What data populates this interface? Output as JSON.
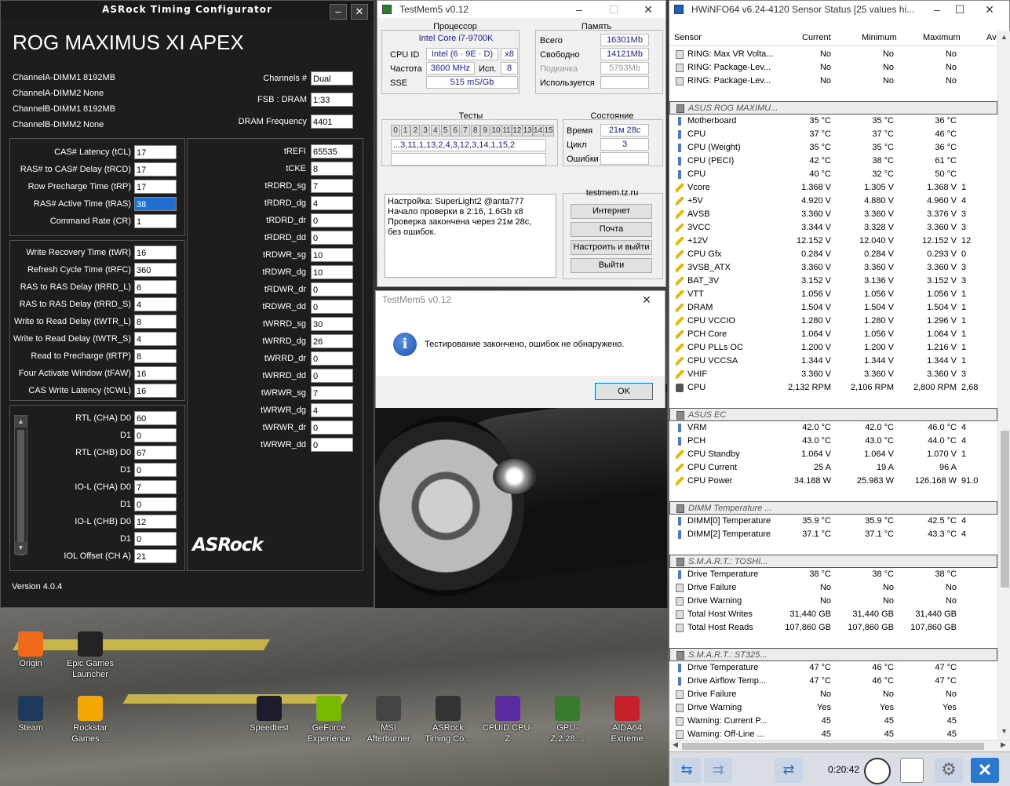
{
  "asrock": {
    "title": "ASRock Timing Configurator",
    "model": "ROG MAXIMUS XI APEX",
    "dimms": [
      {
        "slot": "ChannelA-DIMM1",
        "value": "8192MB"
      },
      {
        "slot": "ChannelA-DIMM2",
        "value": "None"
      },
      {
        "slot": "ChannelB-DIMM1",
        "value": "8192MB"
      },
      {
        "slot": "ChannelB-DIMM2",
        "value": "None"
      }
    ],
    "info": [
      {
        "label": "Channels #",
        "value": "Dual"
      },
      {
        "label": "FSB : DRAM",
        "value": "1:33"
      },
      {
        "label": "DRAM Frequency",
        "value": "4401"
      }
    ],
    "primary": [
      {
        "label": "CAS# Latency (tCL)",
        "value": "17"
      },
      {
        "label": "RAS# to CAS# Delay (tRCD)",
        "value": "17"
      },
      {
        "label": "Row Precharge Time (tRP)",
        "value": "17"
      },
      {
        "label": "RAS# Active Time (tRAS)",
        "value": "38"
      },
      {
        "label": "Command Rate (CR)",
        "value": "1"
      }
    ],
    "secondary": [
      {
        "label": "Write Recovery Time (tWR)",
        "value": "16"
      },
      {
        "label": "Refresh Cycle Time (tRFC)",
        "value": "360"
      },
      {
        "label": "RAS to RAS Delay (tRRD_L)",
        "value": "6"
      },
      {
        "label": "RAS to RAS Delay (tRRD_S)",
        "value": "4"
      },
      {
        "label": "Write to Read Delay (tWTR_L)",
        "value": "8"
      },
      {
        "label": "Write to Read Delay (tWTR_S)",
        "value": "4"
      },
      {
        "label": "Read to Precharge (tRTP)",
        "value": "8"
      },
      {
        "label": "Four Activate Window (tFAW)",
        "value": "16"
      },
      {
        "label": "CAS Write Latency (tCWL)",
        "value": "16"
      }
    ],
    "third": [
      {
        "label": "RTL (CHA) D0",
        "value": "60"
      },
      {
        "label": "D1",
        "value": "0"
      },
      {
        "label": "RTL (CHB) D0",
        "value": "67"
      },
      {
        "label": "D1",
        "value": "0"
      },
      {
        "label": "IO-L (CHA) D0",
        "value": "7"
      },
      {
        "label": "D1",
        "value": "0"
      },
      {
        "label": "IO-L (CHB) D0",
        "value": "12"
      },
      {
        "label": "D1",
        "value": "0"
      },
      {
        "label": "IOL Offset (CH A)",
        "value": "21"
      }
    ],
    "right": [
      {
        "label": "tREFI",
        "value": "65535"
      },
      {
        "label": "tCKE",
        "value": "8"
      },
      {
        "label": "tRDRD_sg",
        "value": "7"
      },
      {
        "label": "tRDRD_dg",
        "value": "4"
      },
      {
        "label": "tRDRD_dr",
        "value": "0"
      },
      {
        "label": "tRDRD_dd",
        "value": "0"
      },
      {
        "label": "tRDWR_sg",
        "value": "10"
      },
      {
        "label": "tRDWR_dg",
        "value": "10"
      },
      {
        "label": "tRDWR_dr",
        "value": "0"
      },
      {
        "label": "tRDWR_dd",
        "value": "0"
      },
      {
        "label": "tWRRD_sg",
        "value": "30"
      },
      {
        "label": "tWRRD_dg",
        "value": "26"
      },
      {
        "label": "tWRRD_dr",
        "value": "0"
      },
      {
        "label": "tWRRD_dd",
        "value": "0"
      },
      {
        "label": "tWRWR_sg",
        "value": "7"
      },
      {
        "label": "tWRWR_dg",
        "value": "4"
      },
      {
        "label": "tWRWR_dr",
        "value": "0"
      },
      {
        "label": "tWRWR_dd",
        "value": "0"
      }
    ],
    "logo": "ASRock",
    "version": "Version 4.0.4"
  },
  "testmem": {
    "title": "TestMem5 v0.12",
    "cpu": {
      "header": "Процессор",
      "name": "Intel Core i7-9700K",
      "cpuid_label": "CPU ID",
      "cpuid": "Intel  (6 · 9E · D)",
      "cpuid_x": "x8",
      "freq_label": "Частота",
      "freq": "3600 MHz",
      "use_label": "Исп.",
      "use": "8",
      "sse_label": "SSE",
      "sse": "515 mS/Gb"
    },
    "mem": {
      "header": "Память",
      "total_label": "Всего",
      "total": "16301Mb",
      "free_label": "Свободно",
      "free": "14121Mb",
      "swap_label": "Подкачка",
      "swap": "5793Mb",
      "used_label": "Используется",
      "used": ""
    },
    "tests": {
      "header": "Тесты",
      "nums": [
        "0",
        "1",
        "2",
        "3",
        "4",
        "5",
        "6",
        "7",
        "8",
        "9",
        "10",
        "11",
        "12",
        "13",
        "14",
        "15"
      ],
      "sequence": "...3,11,1,13,2,4,3,12,3,14,1,15,2"
    },
    "state": {
      "header": "Состояние",
      "time_label": "Время",
      "time": "21м 28с",
      "cycle_label": "Цикл",
      "cycle": "3",
      "err_label": "Ошибки",
      "err": ""
    },
    "log": "Настройка: SuperLight2 @anta777\nНачало проверки в 2:16, 1.6Gb x8\nПроверка закончена через 21м 28с,\nбез ошибок.",
    "site": "testmem.tz.ru",
    "buttons": [
      "Интернет",
      "Почта",
      "Настроить и выйти",
      "Выйти"
    ]
  },
  "dialog": {
    "title": "TestMem5 v0.12",
    "message": "Тестирование закончено, ошибок не обнаружено.",
    "ok": "OK"
  },
  "hwinfo": {
    "title": "HWiNFO64 v6.24-4120 Sensor Status [25 values hi...",
    "columns": [
      "Sensor",
      "Current",
      "Minimum",
      "Maximum",
      "Av"
    ],
    "rows": [
      {
        "t": "sq",
        "n": "RING: Max VR Volta...",
        "c": "No",
        "mn": "No",
        "mx": "No",
        "av": ""
      },
      {
        "t": "sq",
        "n": "RING: Package-Lev...",
        "c": "No",
        "mn": "No",
        "mx": "No",
        "av": ""
      },
      {
        "t": "sq",
        "n": "RING: Package-Lev...",
        "c": "No",
        "mn": "No",
        "mx": "No",
        "av": ""
      },
      {
        "t": "gap"
      },
      {
        "t": "grp",
        "n": "ASUS ROG MAXIMU..."
      },
      {
        "t": "temp",
        "n": "Motherboard",
        "c": "35 °C",
        "mn": "35 °C",
        "mx": "36 °C",
        "av": ""
      },
      {
        "t": "temp",
        "n": "CPU",
        "c": "37 °C",
        "mn": "37 °C",
        "mx": "46 °C",
        "av": ""
      },
      {
        "t": "temp",
        "n": "CPU (Weight)",
        "c": "35 °C",
        "mn": "35 °C",
        "mx": "36 °C",
        "av": ""
      },
      {
        "t": "temp",
        "n": "CPU (PECI)",
        "c": "42 °C",
        "mn": "38 °C",
        "mx": "61 °C",
        "av": ""
      },
      {
        "t": "temp",
        "n": "CPU",
        "c": "40 °C",
        "mn": "32 °C",
        "mx": "50 °C",
        "av": ""
      },
      {
        "t": "volt",
        "n": "Vcore",
        "c": "1.368 V",
        "mn": "1.305 V",
        "mx": "1.368 V",
        "av": "1"
      },
      {
        "t": "volt",
        "n": "+5V",
        "c": "4.920 V",
        "mn": "4.880 V",
        "mx": "4.960 V",
        "av": "4"
      },
      {
        "t": "volt",
        "n": "AVSB",
        "c": "3.360 V",
        "mn": "3.360 V",
        "mx": "3.376 V",
        "av": "3"
      },
      {
        "t": "volt",
        "n": "3VCC",
        "c": "3.344 V",
        "mn": "3.328 V",
        "mx": "3.360 V",
        "av": "3"
      },
      {
        "t": "volt",
        "n": "+12V",
        "c": "12.152 V",
        "mn": "12.040 V",
        "mx": "12.152 V",
        "av": "12"
      },
      {
        "t": "volt",
        "n": "CPU Gfx",
        "c": "0.284 V",
        "mn": "0.284 V",
        "mx": "0.293 V",
        "av": "0"
      },
      {
        "t": "volt",
        "n": "3VSB_ATX",
        "c": "3.360 V",
        "mn": "3.360 V",
        "mx": "3.360 V",
        "av": "3"
      },
      {
        "t": "volt",
        "n": "BAT_3V",
        "c": "3.152 V",
        "mn": "3.136 V",
        "mx": "3.152 V",
        "av": "3"
      },
      {
        "t": "volt",
        "n": "VTT",
        "c": "1.056 V",
        "mn": "1.056 V",
        "mx": "1.056 V",
        "av": "1"
      },
      {
        "t": "volt",
        "n": "DRAM",
        "c": "1.504 V",
        "mn": "1.504 V",
        "mx": "1.504 V",
        "av": "1"
      },
      {
        "t": "volt",
        "n": "CPU VCCIO",
        "c": "1.280 V",
        "mn": "1.280 V",
        "mx": "1.296 V",
        "av": "1"
      },
      {
        "t": "volt",
        "n": "PCH Core",
        "c": "1.064 V",
        "mn": "1.056 V",
        "mx": "1.064 V",
        "av": "1"
      },
      {
        "t": "volt",
        "n": "CPU PLLs OC",
        "c": "1.200 V",
        "mn": "1.200 V",
        "mx": "1.216 V",
        "av": "1"
      },
      {
        "t": "volt",
        "n": "CPU VCCSA",
        "c": "1.344 V",
        "mn": "1.344 V",
        "mx": "1.344 V",
        "av": "1"
      },
      {
        "t": "volt",
        "n": "VHIF",
        "c": "3.360 V",
        "mn": "3.360 V",
        "mx": "3.360 V",
        "av": "3"
      },
      {
        "t": "fan",
        "n": "CPU",
        "c": "2,132 RPM",
        "mn": "2,106 RPM",
        "mx": "2,800 RPM",
        "av": "2,68"
      },
      {
        "t": "gap"
      },
      {
        "t": "grp",
        "n": "ASUS EC"
      },
      {
        "t": "temp",
        "n": "VRM",
        "c": "42.0 °C",
        "mn": "42.0 °C",
        "mx": "46.0 °C",
        "av": "4"
      },
      {
        "t": "temp",
        "n": "PCH",
        "c": "43.0 °C",
        "mn": "43.0 °C",
        "mx": "44.0 °C",
        "av": "4"
      },
      {
        "t": "volt",
        "n": "CPU Standby",
        "c": "1.064 V",
        "mn": "1.064 V",
        "mx": "1.070 V",
        "av": "1"
      },
      {
        "t": "volt",
        "n": "CPU Current",
        "c": "25 A",
        "mn": "19 A",
        "mx": "96 A",
        "av": ""
      },
      {
        "t": "volt",
        "n": "CPU Power",
        "c": "34.188 W",
        "mn": "25.983 W",
        "mx": "126.168 W",
        "av": "91.0"
      },
      {
        "t": "gap"
      },
      {
        "t": "grp",
        "n": "DIMM Temperature ..."
      },
      {
        "t": "temp",
        "n": "DIMM[0] Temperature",
        "c": "35.9 °C",
        "mn": "35.9 °C",
        "mx": "42.5 °C",
        "av": "4"
      },
      {
        "t": "temp",
        "n": "DIMM[2] Temperature",
        "c": "37.1 °C",
        "mn": "37.1 °C",
        "mx": "43.3 °C",
        "av": "4"
      },
      {
        "t": "gap"
      },
      {
        "t": "grp",
        "n": "S.M.A.R.T.: TOSHI..."
      },
      {
        "t": "temp",
        "n": "Drive Temperature",
        "c": "38 °C",
        "mn": "38 °C",
        "mx": "38 °C",
        "av": ""
      },
      {
        "t": "sq",
        "n": "Drive Failure",
        "c": "No",
        "mn": "No",
        "mx": "No",
        "av": ""
      },
      {
        "t": "sq",
        "n": "Drive Warning",
        "c": "No",
        "mn": "No",
        "mx": "No",
        "av": ""
      },
      {
        "t": "sq",
        "n": "Total Host Writes",
        "c": "31,440 GB",
        "mn": "31,440 GB",
        "mx": "31,440 GB",
        "av": ""
      },
      {
        "t": "sq",
        "n": "Total Host Reads",
        "c": "107,860 GB",
        "mn": "107,860 GB",
        "mx": "107,860 GB",
        "av": ""
      },
      {
        "t": "gap"
      },
      {
        "t": "grp",
        "n": "S.M.A.R.T.: ST325..."
      },
      {
        "t": "temp",
        "n": "Drive Temperature",
        "c": "47 °C",
        "mn": "46 °C",
        "mx": "47 °C",
        "av": ""
      },
      {
        "t": "temp",
        "n": "Drive Airflow Temp...",
        "c": "47 °C",
        "mn": "46 °C",
        "mx": "47 °C",
        "av": ""
      },
      {
        "t": "sq",
        "n": "Drive Failure",
        "c": "No",
        "mn": "No",
        "mx": "No",
        "av": ""
      },
      {
        "t": "sq",
        "n": "Drive Warning",
        "c": "Yes",
        "mn": "Yes",
        "mx": "Yes",
        "av": ""
      },
      {
        "t": "sq",
        "n": "Warning: Current P...",
        "c": "45",
        "mn": "45",
        "mx": "45",
        "av": ""
      },
      {
        "t": "sq",
        "n": "Warning: Off-Line ...",
        "c": "45",
        "mn": "45",
        "mx": "45",
        "av": ""
      }
    ],
    "timer": "0:20:42"
  },
  "desktop": {
    "icons": [
      {
        "label": "Origin",
        "color": "#f06a1a"
      },
      {
        "label": "Epic Games Launcher",
        "color": "#222222"
      },
      {
        "label": "Steam",
        "color": "#1b3a5c"
      },
      {
        "label": "Rockstar Games ...",
        "color": "#f2a800"
      },
      {
        "label": "Speedtest",
        "color": "#1c1c2c"
      },
      {
        "label": "GeForce Experience",
        "color": "#76b900"
      },
      {
        "label": "MSI Afterburner",
        "color": "#444444"
      },
      {
        "label": "ASRock Timing Co...",
        "color": "#333333"
      },
      {
        "label": "CPUID CPU-Z",
        "color": "#5a2aa0"
      },
      {
        "label": "GPU-Z.2.28....",
        "color": "#3a7a30"
      },
      {
        "label": "AIDA64 Extreme",
        "color": "#c8202a"
      }
    ]
  }
}
